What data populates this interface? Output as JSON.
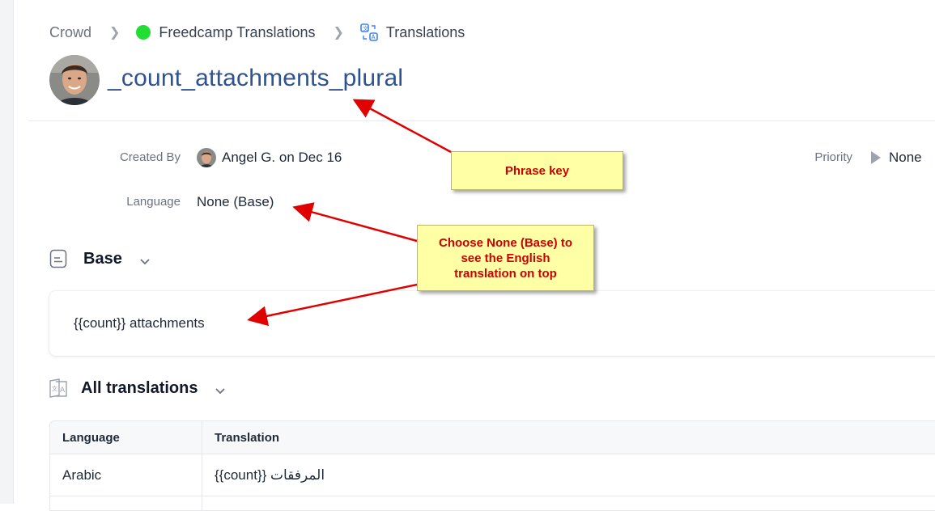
{
  "breadcrumb": {
    "root": "Crowd",
    "project": "Freedcamp Translations",
    "section": "Translations"
  },
  "phrase": {
    "title": "_count_attachments_plural"
  },
  "meta": {
    "created_by_label": "Created By",
    "created_by_value": "Angel G. on Dec 16",
    "language_label": "Language",
    "language_value": "None (Base)",
    "priority_label": "Priority",
    "priority_value": "None"
  },
  "base_section": {
    "title": "Base",
    "text": "{{count}} attachments"
  },
  "translations_section": {
    "title": "All translations",
    "columns": [
      "Language",
      "Translation"
    ],
    "rows": [
      {
        "language": "Arabic",
        "translation": "{{count}} المرفقات"
      }
    ]
  },
  "annotations": {
    "phrase_key": "Phrase key",
    "choose_base": [
      "Choose None (Base) to",
      "see the English",
      "translation on top"
    ]
  },
  "colors": {
    "title": "#2f5290",
    "project_dot": "#22dd33",
    "annotation_text": "#cc0000",
    "annotation_bg": "#ffffa6",
    "arrow": "#e00000"
  }
}
